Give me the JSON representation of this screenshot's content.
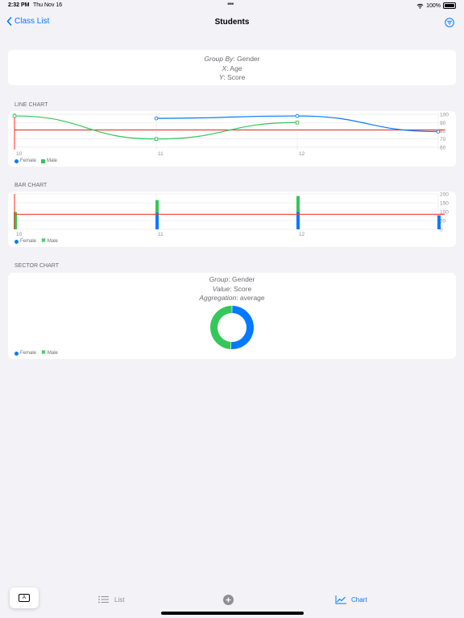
{
  "status": {
    "time": "2:32 PM",
    "date": "Thu Nov 16",
    "dots": "•••",
    "battery": "100%"
  },
  "nav": {
    "back_label": "Class List",
    "title": "Students"
  },
  "config": {
    "group_key": "Group By",
    "group_val": "Gender",
    "x_key": "X",
    "x_val": "Age",
    "y_key": "Y",
    "y_val": "Score"
  },
  "sections": {
    "line": "LINE CHART",
    "bar": "BAR CHART",
    "sector": "SECTOR CHART"
  },
  "sector_config": {
    "group_key": "Group",
    "group_val": "Gender",
    "value_key": "Value",
    "value_val": "Score",
    "agg_key": "Aggregation",
    "agg_val": "average"
  },
  "legend": {
    "female": "Female",
    "male": "Male"
  },
  "colors": {
    "female": "#007aff",
    "male": "#34c759",
    "rule": "#ff3b30",
    "grid": "#e5e5ea",
    "axis": "#8e8e93"
  },
  "icons": {
    "back": "chevron-left-icon",
    "filter": "filter-circle-icon",
    "list": "list-icon",
    "add": "plus-circle-icon",
    "chart": "chart-icon",
    "keyboard": "keyboard-icon"
  },
  "tabs": {
    "list": "List",
    "chart": "Chart",
    "keyboard_letter": "A"
  },
  "chart_data": [
    {
      "type": "line",
      "categories": [
        "10",
        "11",
        "12"
      ],
      "series": [
        {
          "name": "Female",
          "x": [
            "11",
            "12",
            "13"
          ],
          "values": [
            95,
            98,
            79
          ]
        },
        {
          "name": "Male",
          "values": [
            98,
            70,
            90
          ]
        }
      ],
      "rule_y": 81,
      "yticks": [
        "100",
        "90",
        "80",
        "70",
        "60"
      ],
      "ylim": [
        57,
        101
      ],
      "legend": [
        "Female",
        "Male"
      ],
      "legend_position": "bottom-left"
    },
    {
      "type": "bar",
      "categories": [
        "10",
        "11",
        "12"
      ],
      "series": [
        {
          "name": "Female",
          "x": [
            "11",
            "12",
            "13"
          ],
          "values": [
            95,
            98,
            79
          ]
        },
        {
          "name": "Male",
          "values": [
            98,
            70,
            90
          ]
        }
      ],
      "stacked": true,
      "rule_y": 85,
      "yticks": [
        "200",
        "150",
        "100",
        "50",
        "0"
      ],
      "ylim": [
        0,
        200
      ],
      "legend": [
        "Female",
        "Male"
      ],
      "legend_position": "bottom-left"
    },
    {
      "type": "pie",
      "style": "donut",
      "labels": [
        "Female",
        "Male"
      ],
      "values": [
        51,
        49
      ],
      "legend": [
        "Female",
        "Male"
      ],
      "legend_position": "bottom-left"
    }
  ]
}
